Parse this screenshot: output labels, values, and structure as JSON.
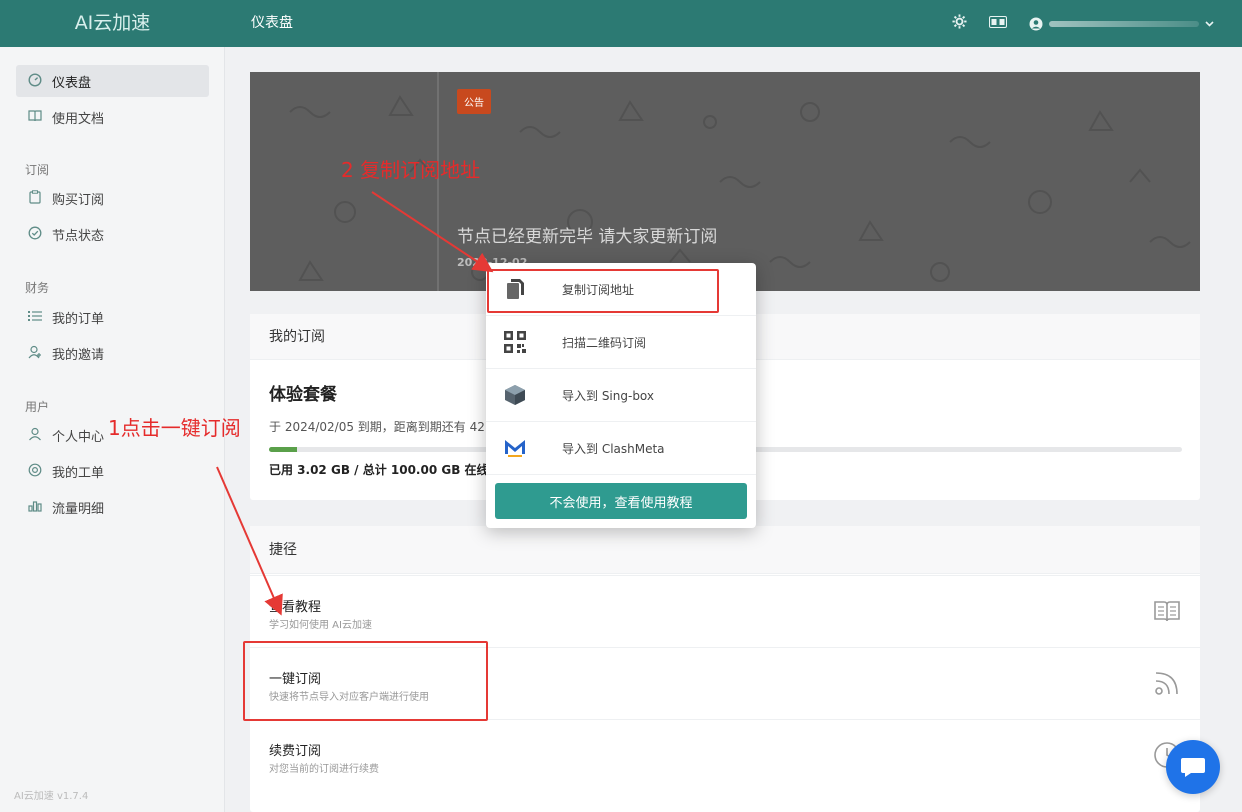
{
  "header": {
    "brand": "AI云加速",
    "title": "仪表盘",
    "icons": [
      "gear-icon",
      "translate-icon",
      "user-icon",
      "chevron-down-icon"
    ]
  },
  "sidebar": {
    "items": [
      {
        "label": "仪表盘",
        "icon": "dashboard-icon",
        "active": true
      },
      {
        "label": "使用文档",
        "icon": "book-icon"
      },
      {
        "label": "购买订阅",
        "icon": "clipboard-icon"
      },
      {
        "label": "节点状态",
        "icon": "check-circle-icon"
      },
      {
        "label": "我的订单",
        "icon": "list-icon"
      },
      {
        "label": "我的邀请",
        "icon": "invite-icon"
      },
      {
        "label": "个人中心",
        "icon": "person-icon"
      },
      {
        "label": "我的工单",
        "icon": "support-icon"
      },
      {
        "label": "流量明细",
        "icon": "bar-chart-icon"
      }
    ],
    "groups": {
      "subscribe": "订阅",
      "finance": "财务",
      "user": "用户"
    },
    "version": "AI云加速 v1.7.4"
  },
  "banner": {
    "badge": "公告",
    "title": "节点已经更新完毕 请大家更新订阅",
    "date": "2023-12-02"
  },
  "subscription": {
    "heading": "我的订阅",
    "plan": "体验套餐",
    "desc": "于 2024/02/05 到期，距离到期还有 42",
    "usage_text": "已用 3.02 GB / 总计 100.00 GB 在线设",
    "used_gb": 3.02,
    "total_gb": 100.0
  },
  "shortcuts": {
    "heading": "捷径",
    "items": [
      {
        "title": "查看教程",
        "sub": "学习如何使用 AI云加速",
        "icon": "book-open-icon"
      },
      {
        "title": "一键订阅",
        "sub": "快速将节点导入对应客户端进行使用",
        "icon": "rss-icon"
      },
      {
        "title": "续费订阅",
        "sub": "对您当前的订阅进行续费",
        "icon": "clock-icon"
      }
    ]
  },
  "popup": {
    "items": [
      {
        "label": "复制订阅地址",
        "icon": "copy-icon"
      },
      {
        "label": "扫描二维码订阅",
        "icon": "qrcode-icon"
      },
      {
        "label": "导入到 Sing-box",
        "icon": "singbox-icon"
      },
      {
        "label": "导入到 ClashMeta",
        "icon": "clashmeta-icon"
      }
    ],
    "button": "不会使用，查看使用教程"
  },
  "annotations": {
    "step1": "1点击一键订阅",
    "step2": "2 复制订阅地址"
  },
  "colors": {
    "header": "#2c7a73",
    "button": "#2f9b90",
    "badge": "#c8491e",
    "annotation": "#e53935",
    "chat": "#1f73e8"
  }
}
